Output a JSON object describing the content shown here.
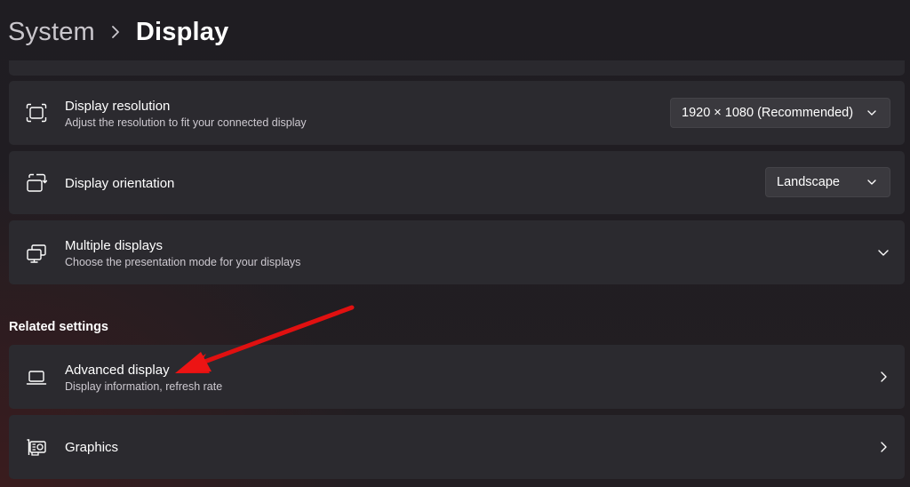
{
  "breadcrumb": {
    "parent": "System",
    "current": "Display"
  },
  "settings": [
    {
      "title": "Display resolution",
      "subtitle": "Adjust the resolution to fit your connected display",
      "icon": "resolution-icon",
      "control": {
        "type": "dropdown",
        "value": "1920 × 1080 (Recommended)"
      }
    },
    {
      "title": "Display orientation",
      "subtitle": "",
      "icon": "orientation-icon",
      "control": {
        "type": "dropdown",
        "value": "Landscape"
      }
    },
    {
      "title": "Multiple displays",
      "subtitle": "Choose the presentation mode for your displays",
      "icon": "multiple-displays-icon",
      "control": {
        "type": "expand"
      }
    }
  ],
  "related": {
    "header": "Related settings",
    "items": [
      {
        "title": "Advanced display",
        "subtitle": "Display information, refresh rate",
        "icon": "laptop-icon"
      },
      {
        "title": "Graphics",
        "subtitle": "",
        "icon": "graphics-card-icon"
      }
    ]
  },
  "colors": {
    "card_bg": "#2b2a2f",
    "dropdown_bg": "#3a393e",
    "annotation_arrow": "#e01010"
  }
}
